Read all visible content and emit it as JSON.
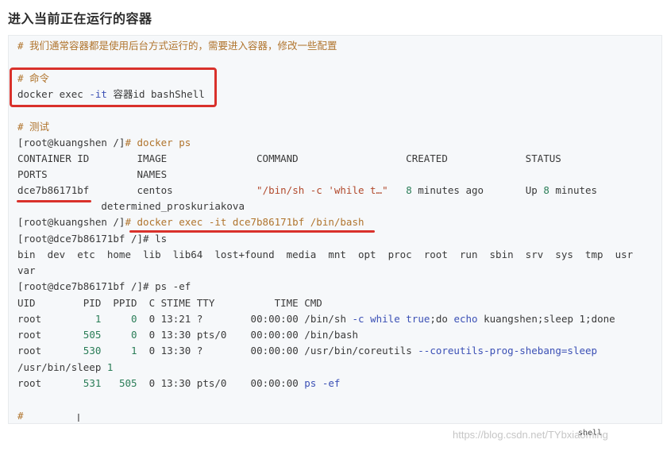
{
  "heading": "进入当前正在运行的容器",
  "lang_tag": "shell",
  "watermark": "https://blog.csdn.net/TYbxiaoming",
  "cursor_glyph": "I",
  "code": {
    "comment1": "# 我们通常容器都是使用后台方式运行的，需要进入容器，修改一些配置",
    "comment2": "# 命令",
    "cmd_docker": "docker exec",
    "cmd_opt": "-it",
    "cmd_rest": "容器id bashShell",
    "comment3": "# 测试",
    "prompt1": "[root@kuangshen /]",
    "prompt1_cmd": "# docker ps",
    "ps_header1": "CONTAINER ID        IMAGE               COMMAND                  CREATED             STATUS",
    "ps_header2": "PORTS               NAMES",
    "ps_row_id": "dce7b86171bf",
    "ps_row_image": "centos",
    "ps_row_cmd": "\"/bin/sh -c 'while t…\"",
    "ps_row_created_num": "8",
    "ps_row_created_rest": "minutes ago",
    "ps_row_status": "Up",
    "ps_row_status_num": "8",
    "ps_row_status_rest": "minutes",
    "ps_row_name": "determined_proskuriakova",
    "prompt2": "[root@kuangshen /]",
    "prompt2_cmd": "# docker exec -it dce7b86171bf /bin/bash",
    "prompt3": "[root@dce7b86171bf /]",
    "prompt3_cmd": "# ls",
    "ls_out1": "bin  dev  etc  home  lib  lib64  lost+found  media  mnt  opt  proc  root  run  sbin  srv  sys  tmp  usr",
    "ls_out2": "var",
    "prompt4": "[root@dce7b86171bf /]",
    "prompt4_cmd": "# ps -ef",
    "ef_header": "UID        PID  PPID  C STIME TTY          TIME CMD",
    "ef_row1_user": "root",
    "ef_row1_pid": "1",
    "ef_row1_ppid": "0",
    "ef_row1_c": "0",
    "ef_row1_mid": "13:21 ?        00:00:00 /bin/sh",
    "ef_row1_opt": "-c",
    "ef_row1_while": "while",
    "ef_row1_true": "true",
    "ef_row1_do": ";do",
    "ef_row1_echo": "echo",
    "ef_row1_tail": "kuangshen;sleep 1;done",
    "ef_row2_user": "root",
    "ef_row2_pid": "505",
    "ef_row2_ppid": "0",
    "ef_row2_c": "0",
    "ef_row2_mid": "13:30 pts/0    00:00:00 /bin/bash",
    "ef_row3_user": "root",
    "ef_row3_pid": "530",
    "ef_row3_ppid": "1",
    "ef_row3_c": "0",
    "ef_row3_mid": "13:30 ?        00:00:00 /usr/bin/coreutils",
    "ef_row3_opt": "--coreutils-prog-shebang=sleep",
    "ef_row3_cont": "/usr/bin/sleep",
    "ef_row3_cont_num": "1",
    "ef_row4_user": "root",
    "ef_row4_pid": "531",
    "ef_row4_ppid": "505",
    "ef_row4_c": "0",
    "ef_row4_mid": "13:30 pts/0    00:00:00",
    "ef_row4_ps": "ps",
    "ef_row4_opt": "-ef",
    "last_prompt": "#"
  },
  "colors": {
    "comment": "#b0742d",
    "keyword": "#3b50b5",
    "string": "#b24a2d",
    "number": "#2a7d57",
    "highlight": "#d9312b"
  }
}
